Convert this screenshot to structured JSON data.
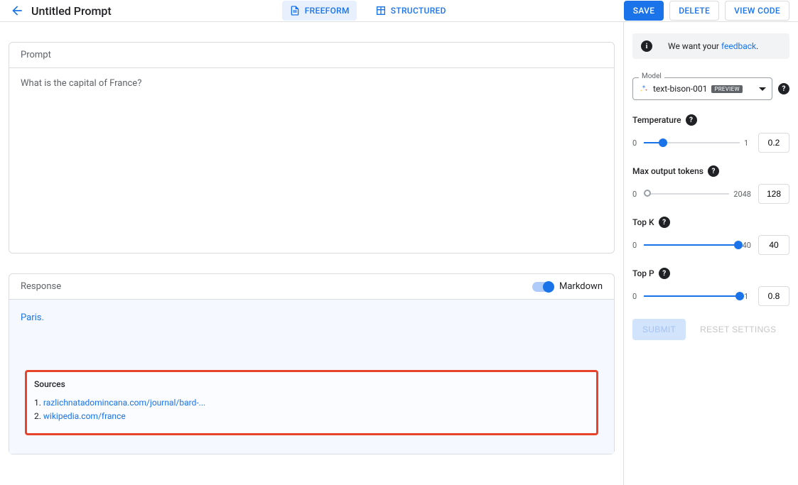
{
  "header": {
    "title": "Untitled Prompt",
    "freeform": "FREEFORM",
    "structured": "STRUCTURED",
    "save": "SAVE",
    "delete": "DELETE",
    "view_code": "VIEW CODE"
  },
  "prompt": {
    "label": "Prompt",
    "text": "What is the capital of France?"
  },
  "response": {
    "label": "Response",
    "markdown_label": "Markdown",
    "text": "Paris.",
    "sources_label": "Sources",
    "sources": [
      "razlichnatadomincana.com/journal/bard-...",
      "wikipedia.com/france"
    ]
  },
  "feedback": {
    "prefix": "We want your ",
    "link": "feedback"
  },
  "model": {
    "legend": "Model",
    "name": "text-bison-001",
    "badge": "PREVIEW"
  },
  "params": {
    "temperature": {
      "label": "Temperature",
      "min": "0",
      "max": "1",
      "value": "0.2",
      "pct": 20
    },
    "max_tokens": {
      "label": "Max output tokens",
      "min": "0",
      "max": "2048",
      "value": "128",
      "pct": 0
    },
    "top_k": {
      "label": "Top K",
      "min": "0",
      "max": "40",
      "value": "40",
      "pct": 100
    },
    "top_p": {
      "label": "Top P",
      "min": "0",
      "max": "1",
      "value": "0.8",
      "pct": 100
    }
  },
  "actions": {
    "submit": "SUBMIT",
    "reset": "RESET SETTINGS"
  }
}
